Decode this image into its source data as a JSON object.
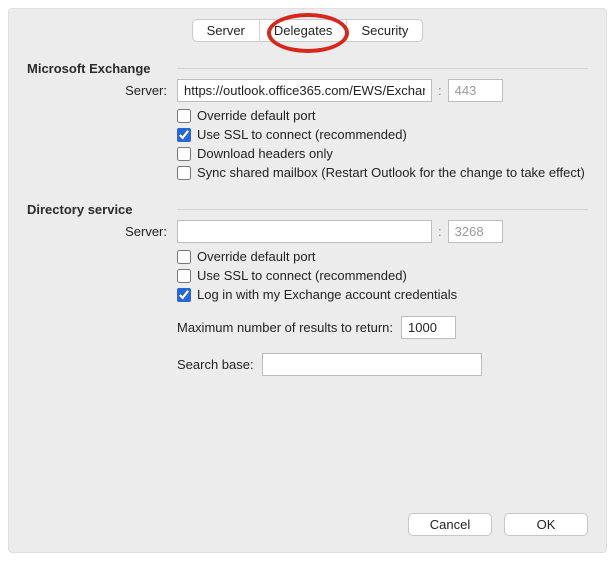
{
  "tabs": {
    "server": "Server",
    "delegates": "Delegates",
    "security": "Security"
  },
  "exchange": {
    "section": "Microsoft Exchange",
    "server_label": "Server:",
    "server_value": "https://outlook.office365.com/EWS/Exchang",
    "port_value": "443",
    "chk_override": "Override default port",
    "chk_ssl": "Use SSL to connect (recommended)",
    "chk_headers": "Download headers only",
    "chk_sync": "Sync shared mailbox (Restart Outlook for the change to take effect)"
  },
  "directory": {
    "section": "Directory service",
    "server_label": "Server:",
    "server_value": "",
    "port_value": "3268",
    "chk_override": "Override default port",
    "chk_ssl": "Use SSL to connect (recommended)",
    "chk_login": "Log in with my Exchange account credentials",
    "max_label": "Maximum number of results to return:",
    "max_value": "1000",
    "search_label": "Search base:",
    "search_value": ""
  },
  "buttons": {
    "cancel": "Cancel",
    "ok": "OK"
  }
}
